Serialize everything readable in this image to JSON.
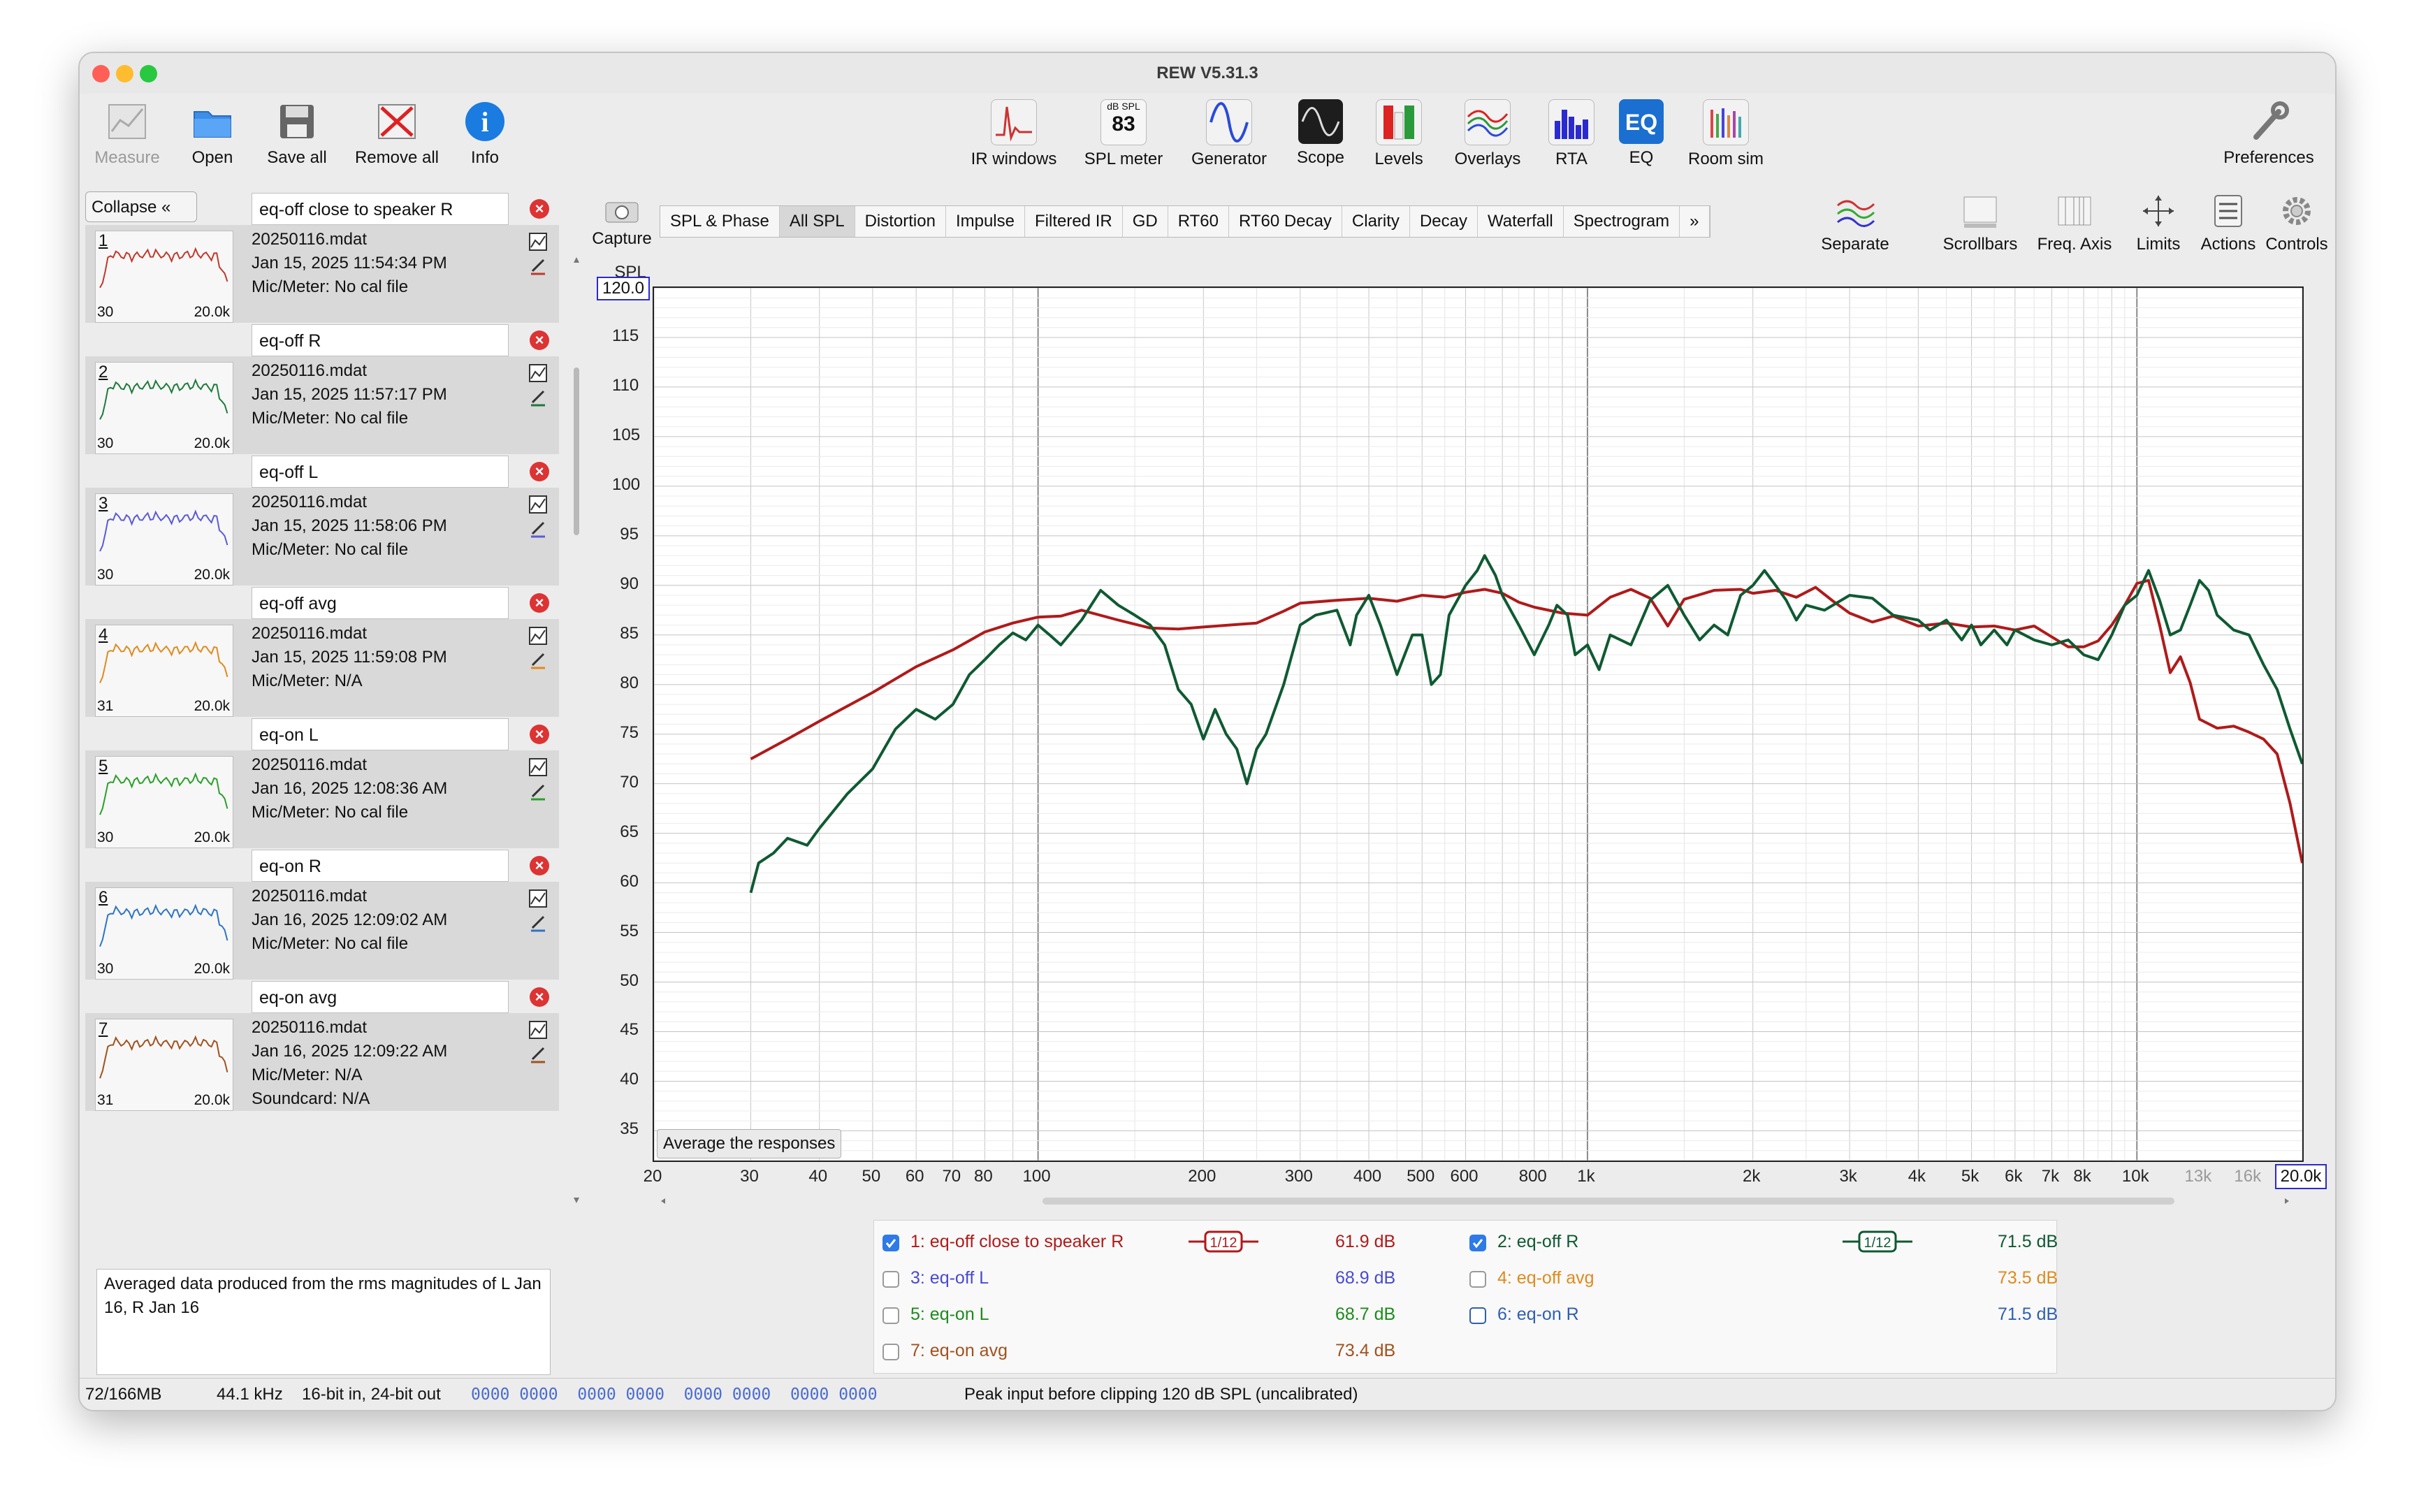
{
  "window": {
    "title": "REW V5.31.3"
  },
  "toolbar_left": [
    {
      "label": "Measure",
      "icon": "measure-icon",
      "enabled": false
    },
    {
      "label": "Open",
      "icon": "folder-icon",
      "enabled": true
    },
    {
      "label": "Save all",
      "icon": "save-icon",
      "enabled": true
    },
    {
      "label": "Remove all",
      "icon": "remove-all-icon",
      "enabled": true
    },
    {
      "label": "Info",
      "icon": "info-icon",
      "enabled": true
    }
  ],
  "toolbar_center": [
    {
      "label": "IR windows",
      "icon": "ir-windows-icon"
    },
    {
      "label": "SPL meter",
      "icon": "spl-meter-icon",
      "meter_unit": "dB SPL",
      "meter_value": "83"
    },
    {
      "label": "Generator",
      "icon": "generator-icon"
    },
    {
      "label": "Scope",
      "icon": "scope-icon"
    },
    {
      "label": "Levels",
      "icon": "levels-icon"
    },
    {
      "label": "Overlays",
      "icon": "overlays-icon"
    },
    {
      "label": "RTA",
      "icon": "rta-icon"
    },
    {
      "label": "EQ",
      "icon": "eq-icon"
    },
    {
      "label": "Room sim",
      "icon": "room-sim-icon"
    }
  ],
  "toolbar_right": {
    "label": "Preferences",
    "icon": "preferences-icon"
  },
  "graph_toolbar": {
    "capture": "Capture",
    "tabs": [
      "SPL & Phase",
      "All SPL",
      "Distortion",
      "Impulse",
      "Filtered IR",
      "GD",
      "RT60",
      "RT60 Decay",
      "Clarity",
      "Decay",
      "Waterfall",
      "Spectrogram",
      "»"
    ],
    "selected_tab": "All SPL",
    "right_buttons": [
      "Separate",
      "Scrollbars",
      "Freq. Axis",
      "Limits",
      "Actions",
      "Controls"
    ]
  },
  "sidebar": {
    "collapse_label": "Collapse «",
    "measurements": [
      {
        "index": "1",
        "name": "eq-off close to speaker R",
        "file": "20250116.mdat",
        "date": "Jan 15, 2025 11:54:34 PM",
        "mic": "Mic/Meter: No cal file",
        "lo": "30",
        "hi": "20.0k",
        "color": "#c0392b"
      },
      {
        "index": "2",
        "name": "eq-off R",
        "file": "20250116.mdat",
        "date": "Jan 15, 2025 11:57:17 PM",
        "mic": "Mic/Meter: No cal file",
        "lo": "30",
        "hi": "20.0k",
        "color": "#1e7a3c"
      },
      {
        "index": "3",
        "name": "eq-off L",
        "file": "20250116.mdat",
        "date": "Jan 15, 2025 11:58:06 PM",
        "mic": "Mic/Meter: No cal file",
        "lo": "30",
        "hi": "20.0k",
        "color": "#5b5bd6"
      },
      {
        "index": "4",
        "name": "eq-off avg",
        "file": "20250116.mdat",
        "date": "Jan 15, 2025 11:59:08 PM",
        "mic": "Mic/Meter: N/A",
        "lo": "31",
        "hi": "20.0k",
        "color": "#e08a1e"
      },
      {
        "index": "5",
        "name": "eq-on L",
        "file": "20250116.mdat",
        "date": "Jan 16, 2025 12:08:36 AM",
        "mic": "Mic/Meter: No cal file",
        "lo": "30",
        "hi": "20.0k",
        "color": "#2aa02a"
      },
      {
        "index": "6",
        "name": "eq-on R",
        "file": "20250116.mdat",
        "date": "Jan 16, 2025 12:09:02 AM",
        "mic": "Mic/Meter: No cal file",
        "lo": "30",
        "hi": "20.0k",
        "color": "#2f74c0"
      },
      {
        "index": "7",
        "name": "eq-on avg",
        "file": "20250116.mdat",
        "date": "Jan 16, 2025 12:09:22 AM",
        "mic": "Mic/Meter: N/A",
        "soundcard": "Soundcard: N/A",
        "lo": "31",
        "hi": "20.0k",
        "color": "#a0521e"
      }
    ],
    "notes": "Averaged data produced from the rms magnitudes of L Jan 16, R Jan 16"
  },
  "chart_data": {
    "type": "line",
    "ylabel": "SPL",
    "xscale": "log",
    "xlim": [
      20,
      20000
    ],
    "ylim": [
      32,
      120
    ],
    "y_top_value": "120.0",
    "x_right_value": "20.0k",
    "yticks": [
      115,
      110,
      105,
      100,
      95,
      90,
      85,
      80,
      75,
      70,
      65,
      60,
      55,
      50,
      45,
      40,
      35
    ],
    "xticks": [
      {
        "v": 20,
        "l": "20"
      },
      {
        "v": 30,
        "l": "30"
      },
      {
        "v": 40,
        "l": "40"
      },
      {
        "v": 50,
        "l": "50"
      },
      {
        "v": 60,
        "l": "60"
      },
      {
        "v": 70,
        "l": "70"
      },
      {
        "v": 80,
        "l": "80"
      },
      {
        "v": 100,
        "l": "100"
      },
      {
        "v": 200,
        "l": "200"
      },
      {
        "v": 300,
        "l": "300"
      },
      {
        "v": 400,
        "l": "400"
      },
      {
        "v": 500,
        "l": "500"
      },
      {
        "v": 600,
        "l": "600"
      },
      {
        "v": 800,
        "l": "800"
      },
      {
        "v": 1000,
        "l": "1k"
      },
      {
        "v": 2000,
        "l": "2k"
      },
      {
        "v": 3000,
        "l": "3k"
      },
      {
        "v": 4000,
        "l": "4k"
      },
      {
        "v": 5000,
        "l": "5k"
      },
      {
        "v": 6000,
        "l": "6k"
      },
      {
        "v": 7000,
        "l": "7k"
      },
      {
        "v": 8000,
        "l": "8k"
      },
      {
        "v": 10000,
        "l": "10k"
      },
      {
        "v": 13000,
        "l": "13k"
      },
      {
        "v": 16000,
        "l": "16k"
      }
    ],
    "grid": true,
    "series": [
      {
        "name": "1: eq-off close to speaker R",
        "color": "#b01a1a",
        "points": [
          [
            30,
            72.5
          ],
          [
            35,
            74.5
          ],
          [
            40,
            76.3
          ],
          [
            50,
            79.2
          ],
          [
            60,
            81.8
          ],
          [
            70,
            83.5
          ],
          [
            80,
            85.3
          ],
          [
            90,
            86.2
          ],
          [
            100,
            86.8
          ],
          [
            110,
            86.9
          ],
          [
            120,
            87.5
          ],
          [
            140,
            86.5
          ],
          [
            160,
            85.7
          ],
          [
            180,
            85.6
          ],
          [
            200,
            85.8
          ],
          [
            250,
            86.2
          ],
          [
            280,
            87.4
          ],
          [
            300,
            88.2
          ],
          [
            350,
            88.5
          ],
          [
            400,
            88.7
          ],
          [
            450,
            88.4
          ],
          [
            500,
            89.0
          ],
          [
            550,
            88.8
          ],
          [
            600,
            89.3
          ],
          [
            650,
            89.6
          ],
          [
            700,
            89.2
          ],
          [
            750,
            88.3
          ],
          [
            800,
            87.8
          ],
          [
            900,
            87.2
          ],
          [
            1000,
            87.0
          ],
          [
            1100,
            88.8
          ],
          [
            1200,
            89.6
          ],
          [
            1300,
            88.7
          ],
          [
            1400,
            85.9
          ],
          [
            1500,
            88.6
          ],
          [
            1700,
            89.5
          ],
          [
            1900,
            89.6
          ],
          [
            2000,
            89.2
          ],
          [
            2200,
            89.5
          ],
          [
            2400,
            88.8
          ],
          [
            2600,
            89.8
          ],
          [
            2800,
            88.4
          ],
          [
            3000,
            87.2
          ],
          [
            3300,
            86.3
          ],
          [
            3600,
            86.9
          ],
          [
            4000,
            85.9
          ],
          [
            4500,
            86.2
          ],
          [
            5000,
            85.8
          ],
          [
            5500,
            85.9
          ],
          [
            6000,
            85.5
          ],
          [
            6500,
            85.9
          ],
          [
            7000,
            84.8
          ],
          [
            7500,
            83.8
          ],
          [
            8000,
            83.8
          ],
          [
            8500,
            84.4
          ],
          [
            9000,
            86.0
          ],
          [
            9500,
            88.0
          ],
          [
            10000,
            90.2
          ],
          [
            10500,
            90.5
          ],
          [
            11000,
            86.0
          ],
          [
            11500,
            81.2
          ],
          [
            12000,
            82.8
          ],
          [
            12500,
            80.2
          ],
          [
            13000,
            76.5
          ],
          [
            14000,
            75.6
          ],
          [
            15000,
            75.8
          ],
          [
            16000,
            75.2
          ],
          [
            17000,
            74.5
          ],
          [
            18000,
            73.0
          ],
          [
            19000,
            68.0
          ],
          [
            20000,
            62.0
          ]
        ]
      },
      {
        "name": "2: eq-off R",
        "color": "#0f5a32",
        "points": [
          [
            30,
            59.0
          ],
          [
            31,
            62.0
          ],
          [
            33,
            63.0
          ],
          [
            35,
            64.5
          ],
          [
            38,
            63.8
          ],
          [
            40,
            65.5
          ],
          [
            45,
            69.0
          ],
          [
            50,
            71.5
          ],
          [
            55,
            75.5
          ],
          [
            60,
            77.5
          ],
          [
            65,
            76.5
          ],
          [
            70,
            78.0
          ],
          [
            75,
            81.0
          ],
          [
            80,
            82.5
          ],
          [
            85,
            84.0
          ],
          [
            90,
            85.2
          ],
          [
            95,
            84.5
          ],
          [
            100,
            86.0
          ],
          [
            105,
            85.0
          ],
          [
            110,
            84.0
          ],
          [
            120,
            86.5
          ],
          [
            130,
            89.5
          ],
          [
            140,
            88.0
          ],
          [
            150,
            87.0
          ],
          [
            160,
            86.0
          ],
          [
            170,
            84.0
          ],
          [
            180,
            79.5
          ],
          [
            190,
            78.0
          ],
          [
            200,
            74.5
          ],
          [
            210,
            77.5
          ],
          [
            220,
            75.0
          ],
          [
            230,
            73.5
          ],
          [
            240,
            70.0
          ],
          [
            250,
            73.5
          ],
          [
            260,
            75.0
          ],
          [
            280,
            80.0
          ],
          [
            300,
            86.0
          ],
          [
            320,
            87.0
          ],
          [
            350,
            87.5
          ],
          [
            370,
            84.0
          ],
          [
            380,
            87.0
          ],
          [
            400,
            89.0
          ],
          [
            420,
            86.0
          ],
          [
            450,
            81.0
          ],
          [
            480,
            85.0
          ],
          [
            500,
            85.0
          ],
          [
            520,
            80.0
          ],
          [
            540,
            81.0
          ],
          [
            560,
            87.0
          ],
          [
            600,
            90.0
          ],
          [
            630,
            91.5
          ],
          [
            650,
            93.0
          ],
          [
            680,
            91.0
          ],
          [
            700,
            89.0
          ],
          [
            750,
            86.0
          ],
          [
            800,
            83.0
          ],
          [
            850,
            86.0
          ],
          [
            880,
            88.0
          ],
          [
            920,
            87.0
          ],
          [
            950,
            83.0
          ],
          [
            1000,
            84.0
          ],
          [
            1050,
            81.5
          ],
          [
            1100,
            85.0
          ],
          [
            1200,
            84.0
          ],
          [
            1300,
            88.5
          ],
          [
            1400,
            90.0
          ],
          [
            1500,
            87.0
          ],
          [
            1600,
            84.5
          ],
          [
            1700,
            86.0
          ],
          [
            1800,
            85.0
          ],
          [
            1900,
            89.0
          ],
          [
            2000,
            90.0
          ],
          [
            2100,
            91.5
          ],
          [
            2200,
            90.0
          ],
          [
            2300,
            88.5
          ],
          [
            2400,
            86.5
          ],
          [
            2500,
            88.0
          ],
          [
            2700,
            87.5
          ],
          [
            3000,
            89.0
          ],
          [
            3300,
            88.7
          ],
          [
            3600,
            87.0
          ],
          [
            4000,
            86.5
          ],
          [
            4200,
            85.5
          ],
          [
            4500,
            86.5
          ],
          [
            4800,
            84.5
          ],
          [
            5000,
            86.0
          ],
          [
            5200,
            84.0
          ],
          [
            5500,
            85.5
          ],
          [
            5800,
            84.0
          ],
          [
            6000,
            85.5
          ],
          [
            6500,
            84.5
          ],
          [
            7000,
            84.0
          ],
          [
            7500,
            84.5
          ],
          [
            8000,
            83.0
          ],
          [
            8500,
            82.5
          ],
          [
            9000,
            85.0
          ],
          [
            9500,
            88.0
          ],
          [
            10000,
            89.0
          ],
          [
            10500,
            91.5
          ],
          [
            11000,
            88.5
          ],
          [
            11500,
            85.0
          ],
          [
            12000,
            85.5
          ],
          [
            12500,
            88.0
          ],
          [
            13000,
            90.5
          ],
          [
            13500,
            89.5
          ],
          [
            14000,
            87.0
          ],
          [
            15000,
            85.5
          ],
          [
            16000,
            85.0
          ],
          [
            17000,
            82.0
          ],
          [
            18000,
            79.5
          ],
          [
            19000,
            75.5
          ],
          [
            20000,
            72.0
          ]
        ]
      }
    ]
  },
  "graph_extras": {
    "average_button": "Average the responses"
  },
  "legend": [
    {
      "label": "1: eq-off close to speaker R",
      "value": "61.9 dB",
      "checked": true,
      "color": "#b01a1a",
      "smoothing": "1/12"
    },
    {
      "label": "2: eq-off R",
      "value": "71.5 dB",
      "checked": true,
      "color": "#0f5a32",
      "smoothing": "1/12"
    },
    {
      "label": "3: eq-off L",
      "value": "68.9 dB",
      "checked": false,
      "color": "#4a4ad0"
    },
    {
      "label": "4: eq-off avg",
      "value": "73.5 dB",
      "checked": false,
      "color": "#e08a1e"
    },
    {
      "label": "5: eq-on L",
      "value": "68.7 dB",
      "checked": false,
      "color": "#1e8a1e"
    },
    {
      "label": "6: eq-on R",
      "value": "71.5 dB",
      "checked": false,
      "color": "#2f5fb0"
    },
    {
      "label": "7: eq-on avg",
      "value": "73.4 dB",
      "checked": false,
      "color": "#a0521e"
    }
  ],
  "status_bar": {
    "memory": "72/166MB",
    "rate": "44.1 kHz",
    "bits": "16-bit in, 24-bit out",
    "signal": "0000 0000  0000 0000  0000 0000  0000 0000",
    "peak": "Peak input before clipping 120 dB SPL (uncalibrated)"
  }
}
